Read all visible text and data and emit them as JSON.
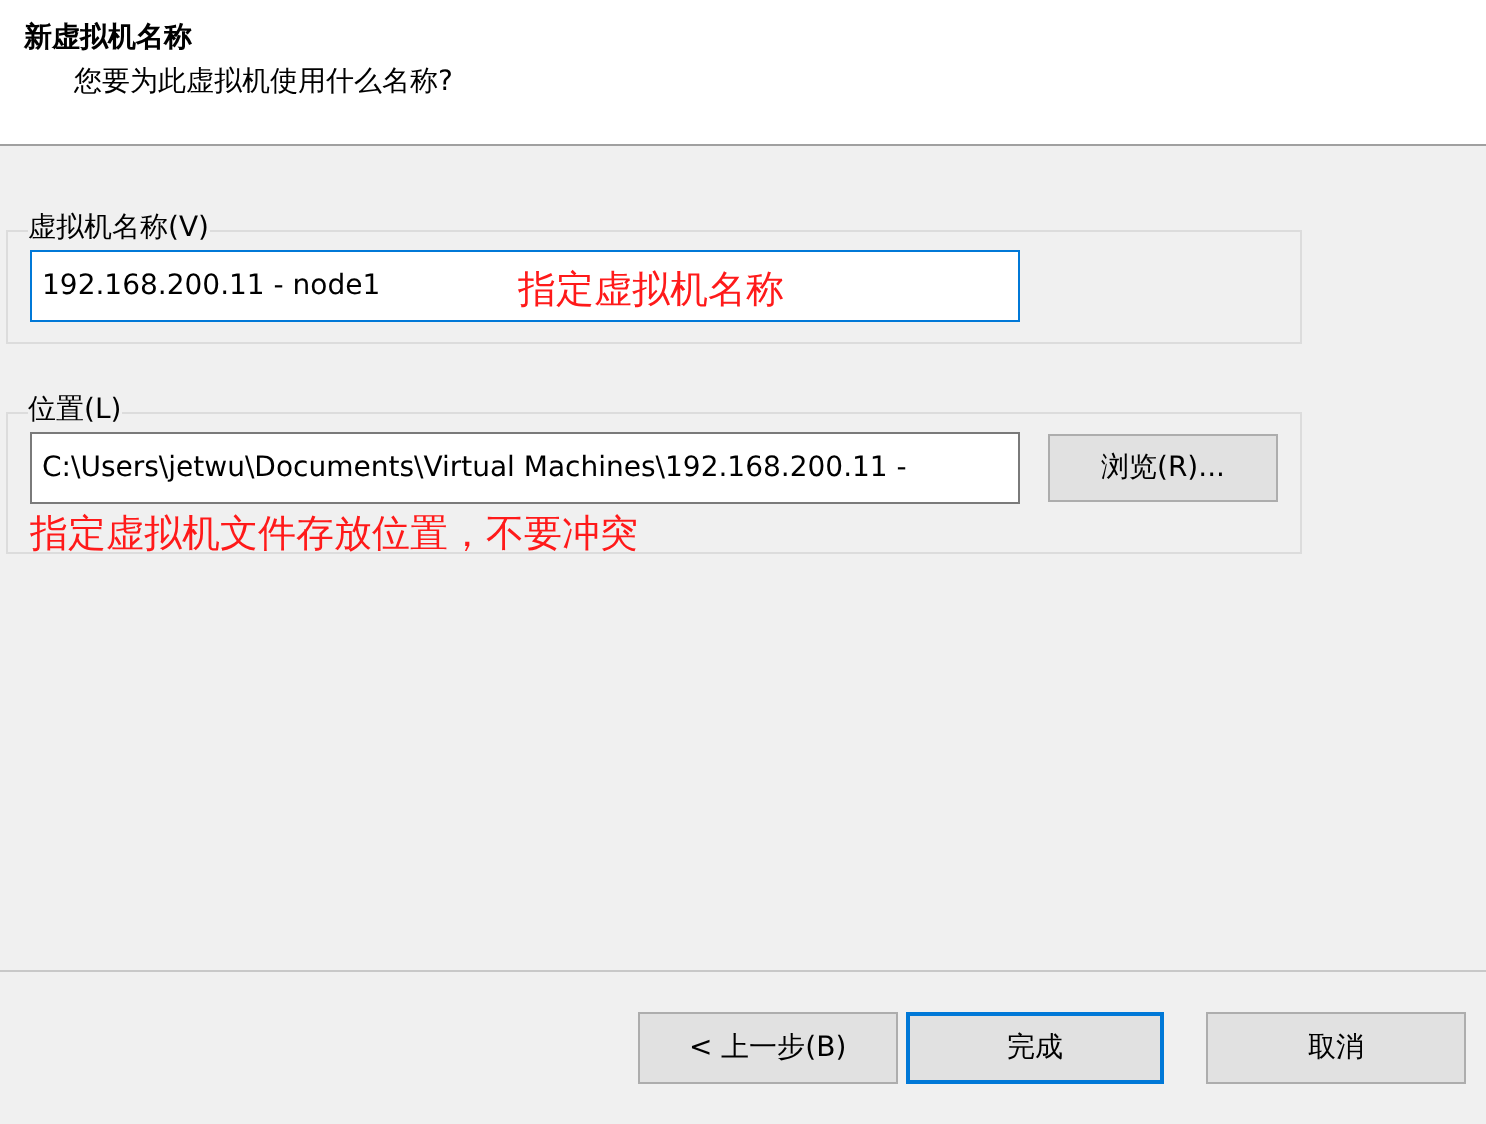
{
  "header": {
    "title": "新虚拟机名称",
    "subtitle": "您要为此虚拟机使用什么名称?"
  },
  "groups": [
    {
      "label": "虚拟机名称(V)",
      "field": {
        "value": "192.168.200.11 - node1",
        "focused": true
      },
      "note": {
        "kind": "inline",
        "text": "指定虚拟机名称"
      }
    },
    {
      "label": "位置(L)",
      "field": {
        "value": "C:\\Users\\jetwu\\Documents\\Virtual Machines\\192.168.200.11 -",
        "focused": false
      },
      "button": "浏览(R)...",
      "note": {
        "kind": "below",
        "text": "指定虚拟机文件存放位置，不要冲突"
      }
    }
  ],
  "buttons": [
    {
      "label": "< 上一步(B)",
      "default": false
    },
    {
      "label": "完成",
      "default": true
    },
    {
      "label": "取消",
      "default": false
    }
  ]
}
